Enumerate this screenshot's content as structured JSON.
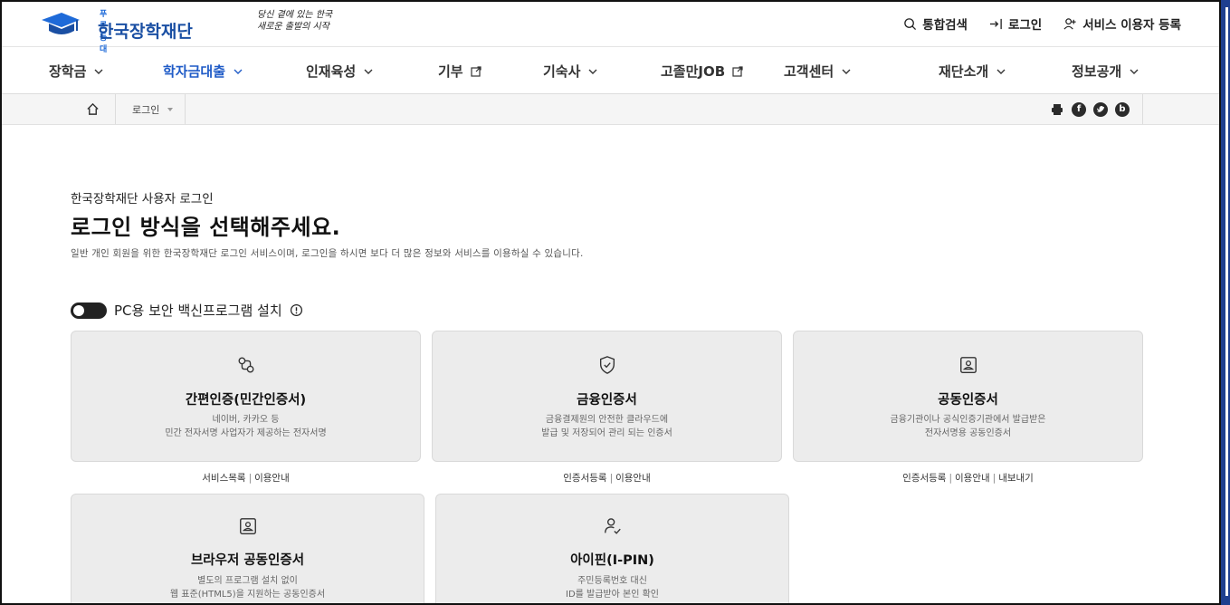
{
  "header": {
    "logo_small": "푸른등대",
    "logo_text": "한국장학재단",
    "slogan_line1": "당신 곁에 있는 한국",
    "slogan_line2": "새로운 출발의 시작",
    "search_label": "통합검색",
    "login_label": "로그인",
    "register_label": "서비스 이용자 등록"
  },
  "nav": {
    "items": [
      {
        "label": "장학금",
        "type": "dropdown"
      },
      {
        "label": "학자금대출",
        "type": "dropdown"
      },
      {
        "label": "인재육성",
        "type": "dropdown"
      },
      {
        "label": "기부",
        "type": "external"
      },
      {
        "label": "기숙사",
        "type": "dropdown"
      },
      {
        "label": "고졸만JOB",
        "type": "external"
      },
      {
        "label": "고객센터",
        "type": "dropdown"
      },
      {
        "label": "재단소개",
        "type": "dropdown"
      },
      {
        "label": "정보공개",
        "type": "dropdown"
      }
    ],
    "active_index": 1
  },
  "breadcrumb": {
    "current": "로그인"
  },
  "share": {
    "icons": [
      "print-icon",
      "facebook-icon",
      "twitter-icon",
      "blog-icon"
    ],
    "facebook_glyph": "f",
    "blog_glyph": "b"
  },
  "main": {
    "subtitle": "한국장학재단 사용자 로그인",
    "title": "로그인 방식을 선택해주세요.",
    "description": "일반 개인 회원을 위한 한국장학재단 로그인 서비스이며, 로그인을 하시면 보다 더 많은 정보와 서비스를 이용하실 수 있습니다.",
    "toggle_label": "PC용 보안 백신프로그램 설치",
    "toggle_on": false
  },
  "cards": [
    {
      "icon": "link-icon",
      "title": "간편인증(민간인증서)",
      "desc_line1": "네이버, 카카오 등",
      "desc_line2": "민간 전자서명 사업자가 제공하는 전자서명",
      "links": [
        "서비스목록",
        "이용안내"
      ]
    },
    {
      "icon": "shield-check-icon",
      "title": "금융인증서",
      "desc_line1": "금융결제원의 안전한 클라우드에",
      "desc_line2": "발급 및 저장되어 관리 되는 인증서",
      "links": [
        "인증서등록",
        "이용안내"
      ]
    },
    {
      "icon": "id-card-icon",
      "title": "공동인증서",
      "desc_line1": "금융기관이나 공식인증기관에서 발급받은",
      "desc_line2": "전자서명용 공동인증서",
      "links": [
        "인증서등록",
        "이용안내",
        "내보내기"
      ]
    },
    {
      "icon": "id-card-icon",
      "title": "브라우저 공동인증서",
      "desc_line1": "별도의 프로그램 설치 없이",
      "desc_line2": "웹 표준(HTML5)을 지원하는 공동인증서"
    },
    {
      "icon": "user-check-icon",
      "title": "아이핀(I-PIN)",
      "desc_line1": "주민등록번호 대신",
      "desc_line2": "ID를 발급받아 본인 확인"
    }
  ],
  "colors": {
    "accent": "#1f5bc7",
    "brand": "#1a4fa3",
    "card_bg": "#ececec",
    "scrollbar": "#1e3f8f"
  }
}
